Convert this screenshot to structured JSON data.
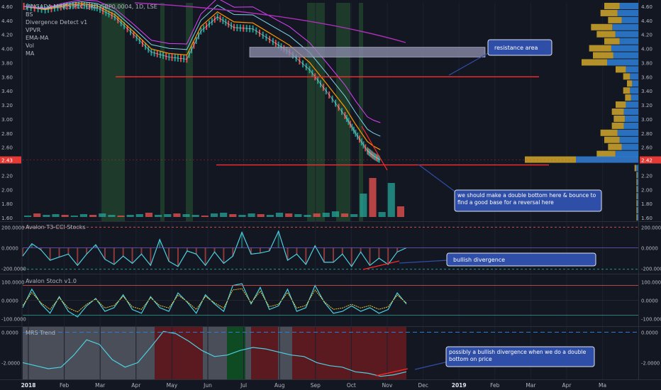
{
  "colors": {
    "background": "#131722",
    "pane_border": "#2a2e39",
    "axis_text": "#b2b5be",
    "up_bar": "#26a69a",
    "down_bar": "#ef5350",
    "green_zone": "#1d3a2a",
    "red_zone": "#5a1a1f",
    "grey_zone": "#4a4e58",
    "price_line": "#ffffff",
    "ema_orange": "#ff9800",
    "ema_cyan": "#7fd3e6",
    "ma_purple": "#b02fb8",
    "ma_magenta": "#e040fb",
    "resistance": "#ff2a2a",
    "annotation_fill": "#2f4ea8",
    "annotation_border": "#e0e3eb",
    "vpvr_blue": "#2c7bd0",
    "vpvr_gold": "#c8a02a",
    "cci_line": "#4dd0e1",
    "stoch_line": "#4dd0e1",
    "stoch_signal": "#fdd835",
    "mrs_line": "#4dd0e1"
  },
  "chart_data": [
    {
      "type": "line",
      "pane": "price",
      "title": "JANGADA MINES PLC ORD GBP0.0004, 1D, LSE",
      "legend": [
        "BS",
        "Divergence Detect v1",
        "VPVR",
        "EMA-MA",
        "Vol",
        "MA"
      ],
      "x": [
        "2018-01-02",
        "2018-01-20",
        "2018-02-05",
        "2018-02-20",
        "2018-03-05",
        "2018-03-20",
        "2018-04-05",
        "2018-04-20",
        "2018-05-05",
        "2018-05-20",
        "2018-06-01",
        "2018-06-15",
        "2018-06-29",
        "2018-07-15",
        "2018-08-01",
        "2018-08-15",
        "2018-09-01",
        "2018-09-15",
        "2018-10-01",
        "2018-10-10",
        "2018-10-20",
        "2018-10-25",
        "2018-10-31"
      ],
      "series": [
        {
          "values": [
            4.6,
            4.55,
            4.6,
            4.62,
            4.58,
            4.45,
            4.2,
            3.95,
            3.88,
            3.85,
            4.25,
            4.45,
            4.3,
            4.28,
            4.1,
            3.95,
            3.7,
            3.4,
            3.05,
            2.8,
            2.55,
            2.48,
            2.42
          ]
        }
      ],
      "ylim": [
        1.55,
        4.65
      ],
      "yticks": [
        "4.60",
        "4.40",
        "4.20",
        "4.00",
        "3.80",
        "3.60",
        "3.40",
        "3.20",
        "3.00",
        "2.80",
        "2.60",
        "2.40",
        "2.20",
        "2.00",
        "1.80",
        "1.60"
      ],
      "last_price_label": "2.42",
      "left_price_label": "2.43",
      "resistance_levels": [
        3.6,
        2.42
      ],
      "resistance_area": [
        3.88,
        4.02
      ],
      "vpvr_levels": [
        4.6,
        4.5,
        4.4,
        4.3,
        4.2,
        4.1,
        4.0,
        3.9,
        3.8,
        3.7,
        3.6,
        3.5,
        3.4,
        3.3,
        3.2,
        3.1,
        3.0,
        2.9,
        2.8,
        2.7,
        2.6,
        2.5,
        2.42,
        2.3,
        2.2,
        2.1,
        2.0,
        1.9,
        1.8,
        1.7,
        1.6
      ],
      "vpvr_volumes": [
        0.18,
        0.2,
        0.16,
        0.25,
        0.22,
        0.18,
        0.26,
        0.24,
        0.3,
        0.12,
        0.08,
        0.06,
        0.08,
        0.07,
        0.12,
        0.14,
        0.13,
        0.14,
        0.2,
        0.18,
        0.16,
        0.22,
        0.6,
        0.02,
        0.01,
        0.01,
        0.01,
        0.01,
        0.01,
        0.01,
        0.01
      ]
    },
    {
      "type": "line",
      "pane": "cci",
      "title": "Avalon T3-CCI Stocks",
      "ylim": [
        -250,
        250
      ],
      "yticks": [
        "200.0000",
        "0.0000",
        "-200.0000"
      ],
      "x_fraction_note": "values sampled evenly across Jan–Oct 2018",
      "values": [
        -80,
        40,
        -20,
        -120,
        -90,
        -60,
        -170,
        -60,
        30,
        -110,
        -160,
        -80,
        -150,
        -60,
        -170,
        80,
        -130,
        -180,
        -30,
        -60,
        -170,
        -40,
        -150,
        -80,
        150,
        -60,
        -50,
        -30,
        160,
        -120,
        -60,
        -160,
        20,
        -140,
        -140,
        -60,
        -180,
        -40,
        -170,
        -100,
        -160,
        -40,
        0
      ]
    },
    {
      "type": "line",
      "pane": "stoch",
      "title": "Avalon Stoch v1.0",
      "ylim": [
        -140,
        140
      ],
      "yticks": [
        "100.0000",
        "0.0000",
        "-100.0000"
      ],
      "values": [
        -40,
        60,
        -20,
        -70,
        20,
        -60,
        -90,
        -30,
        10,
        -60,
        -40,
        30,
        -50,
        -70,
        20,
        -40,
        -60,
        40,
        -10,
        -70,
        30,
        -20,
        -60,
        80,
        90,
        -20,
        70,
        -50,
        -30,
        60,
        -60,
        -40,
        80,
        -10,
        -70,
        -60,
        -30,
        -60,
        -40,
        -70,
        -50,
        40,
        -20
      ]
    },
    {
      "type": "line",
      "pane": "mrs",
      "title": "MRS Trend",
      "ylim": [
        -3.1,
        0.35
      ],
      "yticks": [
        "0.0000",
        "-2.0000"
      ],
      "values": [
        -2.0,
        -2.2,
        -2.4,
        -2.3,
        -1.5,
        -0.5,
        -0.8,
        -1.8,
        -2.3,
        -2.0,
        -1.0,
        0.05,
        -0.1,
        -0.6,
        -1.2,
        -1.6,
        -1.5,
        -1.2,
        -1.0,
        -1.1,
        -1.3,
        -1.5,
        -1.6,
        -2.0,
        -2.2,
        -2.3,
        -2.6,
        -2.7,
        -2.9,
        -2.8,
        -2.6
      ]
    },
    {
      "type": "bar",
      "pane": "volume",
      "values": [
        0.2,
        0.5,
        0.3,
        0.4,
        0.3,
        0.2,
        0.4,
        0.3,
        0.5,
        0.3,
        0.2,
        0.3,
        0.4,
        0.6,
        0.3,
        0.4,
        0.5,
        0.4,
        0.3,
        0.2,
        0.5,
        0.6,
        0.4,
        0.3,
        0.5,
        0.4,
        0.3,
        0.6,
        0.5,
        0.4,
        0.3,
        0.5,
        0.6,
        0.8,
        0.5,
        0.4,
        3.3,
        5.5,
        0.7,
        4.8,
        1.5
      ]
    }
  ],
  "x_axis": {
    "labels": [
      "2018",
      "Feb",
      "Mar",
      "Apr",
      "May",
      "Jun",
      "Jul",
      "Aug",
      "Sep",
      "Oct",
      "Nov",
      "Dec",
      "2019",
      "Feb",
      "Mar",
      "Apr",
      "Ma"
    ]
  },
  "annotations": {
    "resistance": "resistance area",
    "double_bottom": "we should make a double bottom here & bounce to find a good base for a reversal here",
    "bullish": "bullish divergence",
    "possibly": "possibly a bullish divergence when we do a double bottom on price"
  }
}
